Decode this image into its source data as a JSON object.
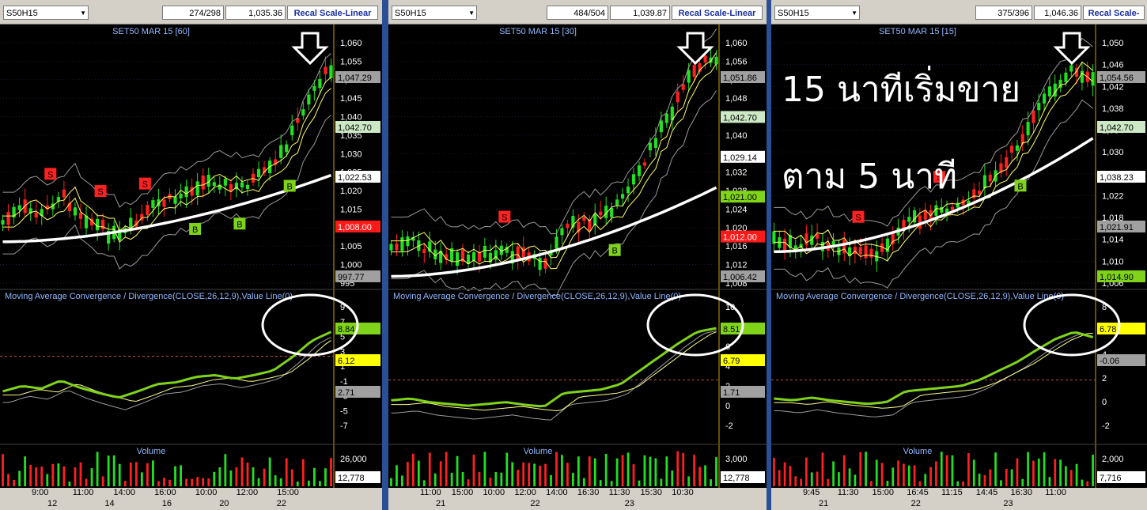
{
  "panels": [
    {
      "id": "p60",
      "ticker": "S50H15",
      "stat1": "274/298",
      "stat2": "1,035.36",
      "recal": "Recal Scale-Linear",
      "title": "SET50 MAR 15  [60]",
      "price_ticks": [
        "1,060",
        "1,055",
        "1,050",
        "1,045",
        "1,040",
        "1,035",
        "1,030",
        "1,025",
        "1,020",
        "1,015",
        "1,010",
        "1,005",
        "1,000",
        "995"
      ],
      "price_tags": [
        {
          "text": "1,047.29",
          "bg": "#a0a0a0",
          "fg": "#000"
        },
        {
          "text": "1,042.70",
          "bg": "#cde8c5",
          "fg": "#000"
        },
        {
          "text": "1,022.53",
          "bg": "#ffffff",
          "fg": "#000"
        },
        {
          "text": "1,008.00",
          "bg": "#ff1a1a",
          "fg": "#fff"
        },
        {
          "text": "997.77",
          "bg": "#a0a0a0",
          "fg": "#000"
        }
      ],
      "macd_title": "Moving Average Convergence / Divergence(CLOSE,26,12,9),Value Line(0)",
      "macd_ticks": [
        "9",
        "7",
        "5",
        "3",
        "1",
        "-1",
        "-3",
        "-5",
        "-7"
      ],
      "macd_tags": [
        {
          "text": "8.84",
          "bg": "#7fd319",
          "fg": "#000"
        },
        {
          "text": "6.12",
          "bg": "#ffff00",
          "fg": "#000"
        },
        {
          "text": "2.71",
          "bg": "#a0a0a0",
          "fg": "#000"
        }
      ],
      "volume_title": "Volume",
      "volume_ticks": [
        "26,000"
      ],
      "volume_tag": "12,778",
      "time_labels": [
        "9:00",
        "11:00",
        "14:00",
        "16:00",
        "10:00",
        "12:00",
        "15:00"
      ],
      "date_labels": [
        "12",
        "14",
        "16",
        "20",
        "22"
      ],
      "signals": [
        {
          "t": "S",
          "color": "#ff2020"
        },
        {
          "t": "S",
          "color": "#ff2020"
        },
        {
          "t": "S",
          "color": "#ff2020"
        },
        {
          "t": "B",
          "color": "#7fd319"
        },
        {
          "t": "B",
          "color": "#7fd319"
        },
        {
          "t": "B",
          "color": "#7fd319"
        }
      ]
    },
    {
      "id": "p30",
      "ticker": "S50H15",
      "stat1": "484/504",
      "stat2": "1,039.87",
      "recal": "Recal Scale-Linear",
      "title": "SET50 MAR 15  [30]",
      "price_ticks": [
        "1,060",
        "1,056",
        "1,052",
        "1,048",
        "1,044",
        "1,040",
        "1,036",
        "1,032",
        "1,028",
        "1,024",
        "1,020",
        "1,016",
        "1,012",
        "1,008"
      ],
      "price_tags": [
        {
          "text": "1,051.86",
          "bg": "#a0a0a0",
          "fg": "#000"
        },
        {
          "text": "1,042.70",
          "bg": "#cde8c5",
          "fg": "#000"
        },
        {
          "text": "1,029.14",
          "bg": "#ffffff",
          "fg": "#000"
        },
        {
          "text": "1,021.00",
          "bg": "#7fd319",
          "fg": "#000"
        },
        {
          "text": "1,012.00",
          "bg": "#ff1a1a",
          "fg": "#fff"
        },
        {
          "text": "1,006.42",
          "bg": "#a0a0a0",
          "fg": "#000"
        }
      ],
      "macd_title": "Moving Average Convergence / Divergence(CLOSE,26,12,9),Value Line(0)",
      "macd_ticks": [
        "10",
        "8",
        "6",
        "4",
        "2",
        "0",
        "-2"
      ],
      "macd_tags": [
        {
          "text": "8.51",
          "bg": "#7fd319",
          "fg": "#000"
        },
        {
          "text": "6.79",
          "bg": "#ffff00",
          "fg": "#000"
        },
        {
          "text": "1.71",
          "bg": "#a0a0a0",
          "fg": "#000"
        }
      ],
      "volume_title": "Volume",
      "volume_ticks": [
        "3,000"
      ],
      "volume_tag": "12,778",
      "time_labels": [
        "11:00",
        "15:00",
        "10:00",
        "12:00",
        "14:00",
        "16:30",
        "11:30",
        "15:30",
        "10:30"
      ],
      "date_labels": [
        "21",
        "22",
        "23"
      ],
      "signals": [
        {
          "t": "S",
          "color": "#ff2020"
        },
        {
          "t": "B",
          "color": "#7fd319"
        }
      ]
    },
    {
      "id": "p15",
      "ticker": "S50H15",
      "stat1": "375/396",
      "stat2": "1,046.36",
      "recal": "Recal Scale-Linear",
      "title": "SET50 MAR 15  [15]",
      "price_ticks": [
        "1,050",
        "1,046",
        "1,042",
        "1,038",
        "1,034",
        "1,030",
        "1,026",
        "1,022",
        "1,018",
        "1,014",
        "1,010",
        "1,006"
      ],
      "price_tags": [
        {
          "text": "1,054.56",
          "bg": "#a0a0a0",
          "fg": "#000"
        },
        {
          "text": "1,042.70",
          "bg": "#cde8c5",
          "fg": "#000"
        },
        {
          "text": "1,038.23",
          "bg": "#ffffff",
          "fg": "#000"
        },
        {
          "text": "1,021.91",
          "bg": "#a0a0a0",
          "fg": "#000"
        },
        {
          "text": "1,014.90",
          "bg": "#7fd319",
          "fg": "#000"
        }
      ],
      "macd_title": "Moving Average Convergence / Divergence(CLOSE,26,12,9),Value Line(0)",
      "macd_ticks": [
        "8",
        "6",
        "4",
        "2",
        "0",
        "-2"
      ],
      "macd_tags": [
        {
          "text": "6.78",
          "bg": "#ffff00",
          "fg": "#000"
        },
        {
          "text": "-0.06",
          "bg": "#a0a0a0",
          "fg": "#000"
        }
      ],
      "volume_title": "Volume",
      "volume_ticks": [
        "2,000"
      ],
      "volume_tag": "7,716",
      "time_labels": [
        "9:45",
        "11:30",
        "15:00",
        "16:45",
        "11:15",
        "14:45",
        "16:30",
        "11:00"
      ],
      "date_labels": [
        "21",
        "22",
        "23"
      ],
      "signals": [
        {
          "t": "S",
          "color": "#ff2020"
        },
        {
          "t": "S",
          "color": "#ff2020"
        },
        {
          "t": "B",
          "color": "#7fd319"
        }
      ]
    }
  ],
  "annotations": {
    "line1": "15 นาทีเริ่มขาย",
    "line2": "ตาม 5 นาที"
  },
  "colors": {
    "bull": "#22e022",
    "bear": "#ff2020",
    "ema_long": "#ffffff",
    "ema_short": "#ffff66",
    "bands": "#9a9a9a",
    "macd": "#7fd319",
    "signal": "#ffff88"
  }
}
